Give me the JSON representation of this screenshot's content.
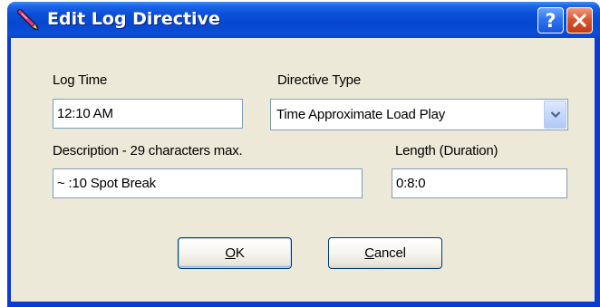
{
  "window": {
    "title": "Edit Log Directive",
    "help_label": "?",
    "close_label": "X"
  },
  "form": {
    "log_time": {
      "label": "Log Time",
      "value": "12:10 AM"
    },
    "directive_type": {
      "label": "Directive Type",
      "value": "Time Approximate Load Play"
    },
    "description": {
      "label": "Description - 29 characters max.",
      "value": "~ :10 Spot Break"
    },
    "length": {
      "label": "Length (Duration)",
      "value": "0:8:0"
    }
  },
  "buttons": {
    "ok": {
      "accel": "O",
      "rest": "K"
    },
    "cancel": {
      "accel": "C",
      "rest": "ancel"
    }
  },
  "icons": {
    "title_icon": "pencil-icon",
    "dropdown_icon": "chevron-down-icon"
  },
  "colors": {
    "titlebar": "#0747d0",
    "client_bg": "#ece9d8",
    "close_button": "#d9562f",
    "input_border": "#7f9db9"
  }
}
